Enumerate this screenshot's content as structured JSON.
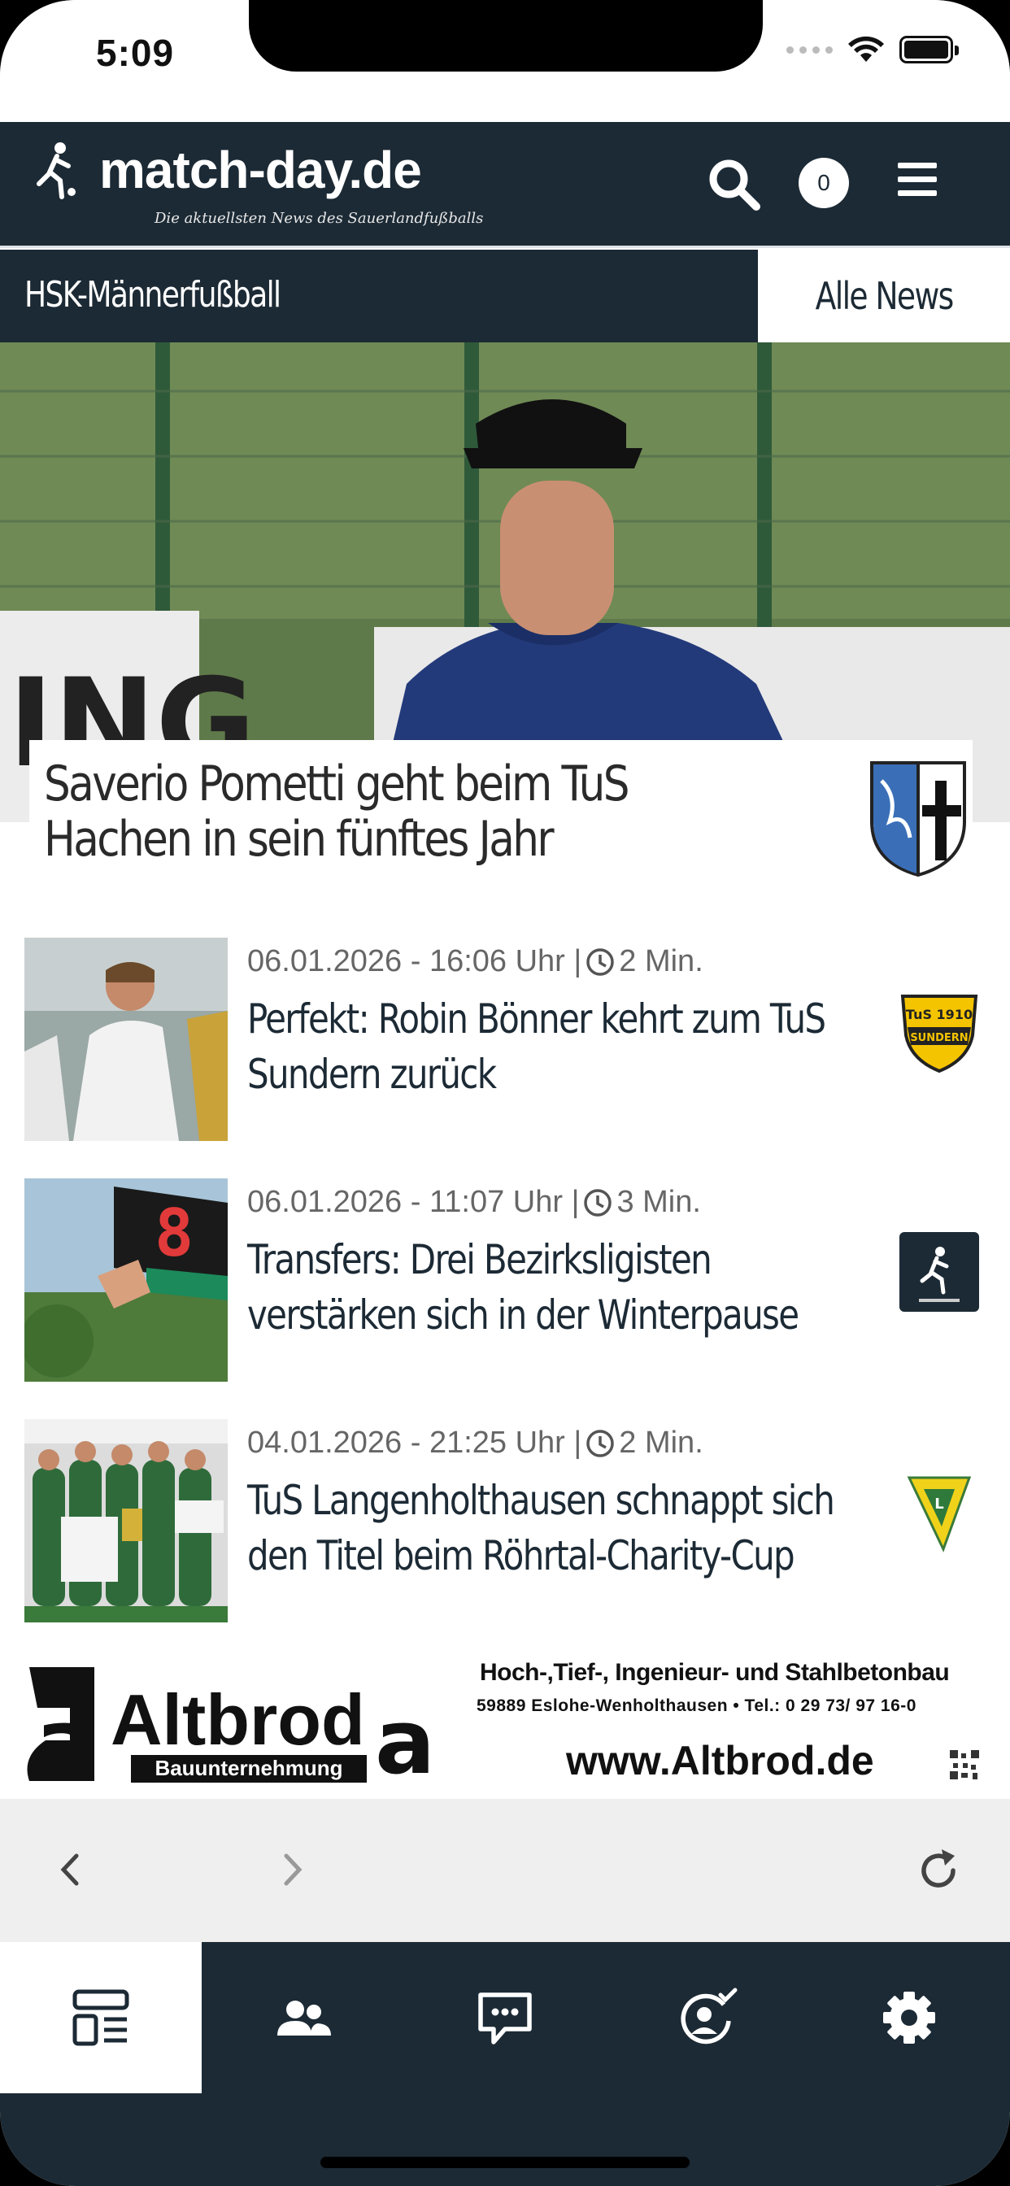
{
  "status_bar": {
    "time": "5:09"
  },
  "header": {
    "logo_text": "match-day.de",
    "tagline": "Die aktuellsten News des Sauerlandfußballs",
    "cart_count": "0"
  },
  "category_bar": {
    "title": "HSK-Männerfußball",
    "all_news_label": "Alle News"
  },
  "hero": {
    "title": "Saverio Pometti geht beim TuS Hachen in sein fünftes Jahr"
  },
  "articles": [
    {
      "date": "06.01.2026 - 16:06 Uhr |",
      "read_time": "2 Min.",
      "title": "Perfekt: Robin Bönner kehrt zum TuS Sundern zurück",
      "club_logo": "tus-sundern-crest"
    },
    {
      "date": "06.01.2026 - 11:07 Uhr |",
      "read_time": "3 Min.",
      "title": "Transfers: Drei Bezirksligisten verstärken sich in der Winterpause",
      "club_logo": "match-day-logo"
    },
    {
      "date": "04.01.2026 - 21:25 Uhr |",
      "read_time": "2 Min.",
      "title": "TuS Langenholthausen schnappt sich den Titel beim Röhrtal-Charity-Cup",
      "club_logo": "tus-langenholthausen-crest"
    }
  ],
  "ad": {
    "brand": "Altbrod",
    "subtitle": "Bauunternehmung",
    "line1": "Hoch-,Tief-, Ingenieur- und Stahlbetonbau",
    "line2": "59889 Eslohe-Wenholthausen • Tel.: 0 29 73/ 97 16-0",
    "url": "www.Altbrod.de"
  },
  "tabbar": {
    "tabs": [
      "news-icon",
      "people-icon",
      "chat-icon",
      "profile-check-icon",
      "settings-icon"
    ],
    "active_index": 0
  },
  "colors": {
    "primary": "#1c2a35",
    "background": "#ffffff",
    "meta_text": "#666666"
  }
}
